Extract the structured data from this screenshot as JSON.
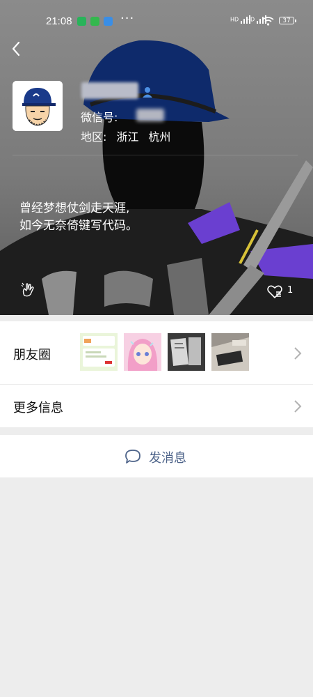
{
  "status_bar": {
    "time": "21:08",
    "dots": "···",
    "signal_1_label": "HD",
    "signal_2_label": "HD",
    "battery": "37"
  },
  "profile": {
    "wechat_id_label": "微信号:",
    "region_label": "地区:",
    "region_province": "浙江",
    "region_city": "杭州",
    "signature_line1": "曾经梦想仗剑走天涯,",
    "signature_line2": "如今无奈倚键写代码。",
    "like_count": "1"
  },
  "rows": {
    "moments_label": "朋友圈",
    "more_info_label": "更多信息"
  },
  "actions": {
    "send_message_label": "发消息"
  },
  "colors": {
    "link_blue": "#4d6389",
    "page_bg": "#ededed",
    "cap_navy": "#0e2a6b",
    "stroke_purple": "#6a3fd0"
  }
}
